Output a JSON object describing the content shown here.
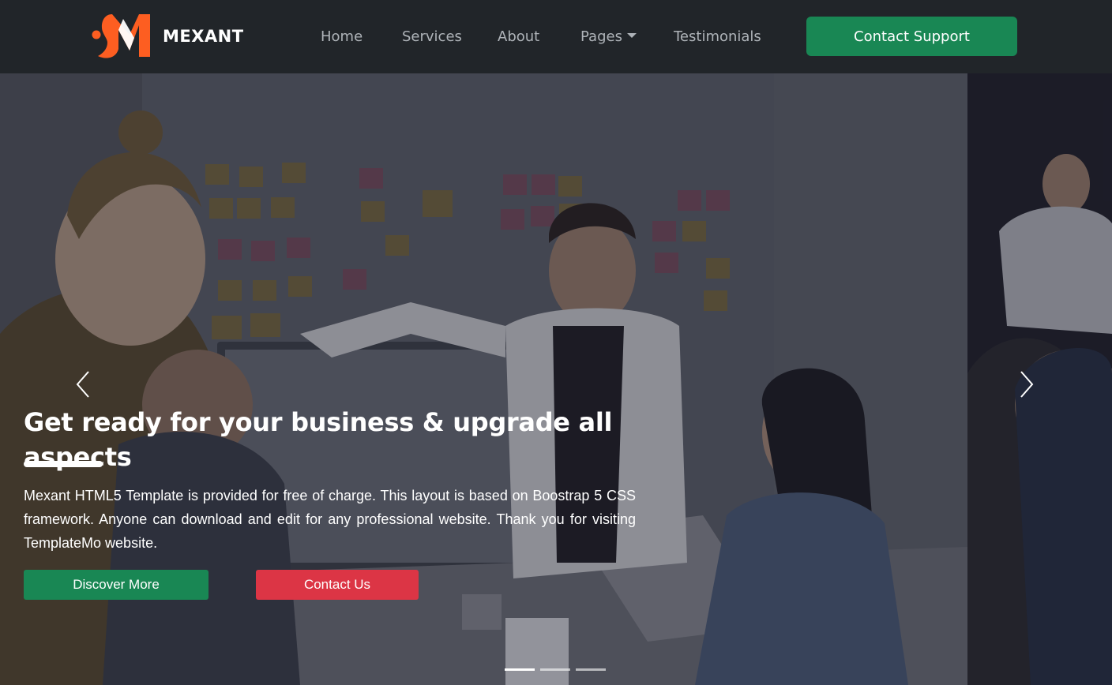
{
  "brand": {
    "name": "MEXANT",
    "logo_color": "#fd5e21"
  },
  "nav": {
    "items": [
      {
        "label": "Home"
      },
      {
        "label": "Services"
      },
      {
        "label": "About"
      },
      {
        "label": "Pages",
        "has_dropdown": true
      },
      {
        "label": "Testimonials"
      }
    ],
    "support_button": "Contact Support"
  },
  "hero": {
    "title": "Get ready for your business & upgrade all aspects",
    "description": "Mexant HTML5 Template is provided for free of charge. This layout is based on Boostrap 5 CSS framework. Anyone can download and edit for any professional website. Thank you for visiting TemplateMo website.",
    "discover_button": "Discover More",
    "contact_button": "Contact Us",
    "prev_icon": "chevron-left-icon",
    "next_icon": "chevron-right-icon",
    "slides": 3,
    "active_slide": 1
  },
  "colors": {
    "nav_bg": "#212529",
    "nav_text": "#aeb3b8",
    "accent_green": "#198754",
    "accent_red": "#dc3545",
    "logo_orange": "#fd5e21"
  }
}
